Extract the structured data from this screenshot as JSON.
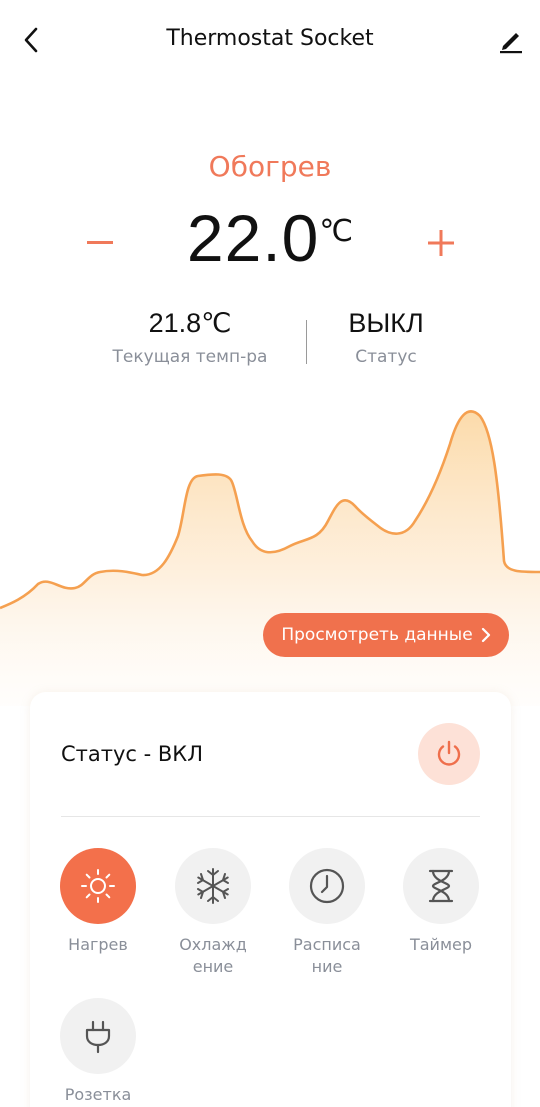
{
  "header": {
    "title": "Thermostat Socket"
  },
  "thermostat": {
    "mode": "Обогрев",
    "setpoint": "22.0",
    "unit": "℃",
    "minus": "−",
    "plus": "+",
    "current_temp": "21.8℃",
    "current_temp_label": "Текущая темп-ра",
    "status_value": "ВЫКЛ",
    "status_label": "Статус"
  },
  "view_data_button": {
    "label": "Просмотреть данные",
    "chevron": "›"
  },
  "control_card": {
    "status_text": "Статус - ВКЛ",
    "modes": [
      {
        "label": "Нагрев",
        "icon": "sun-icon",
        "active": true
      },
      {
        "label": "Охлажд\nение",
        "icon": "snowflake-icon",
        "active": false
      },
      {
        "label": "Расписа\nние",
        "icon": "clock-icon",
        "active": false
      },
      {
        "label": "Таймер",
        "icon": "hourglass-icon",
        "active": false
      },
      {
        "label": "Розетка",
        "icon": "plug-icon",
        "active": false
      }
    ]
  },
  "colors": {
    "accent": "#f0714d",
    "accent_light": "#fde1d7",
    "chart_line": "#f5a050",
    "chart_fill": "#fde6c4"
  }
}
